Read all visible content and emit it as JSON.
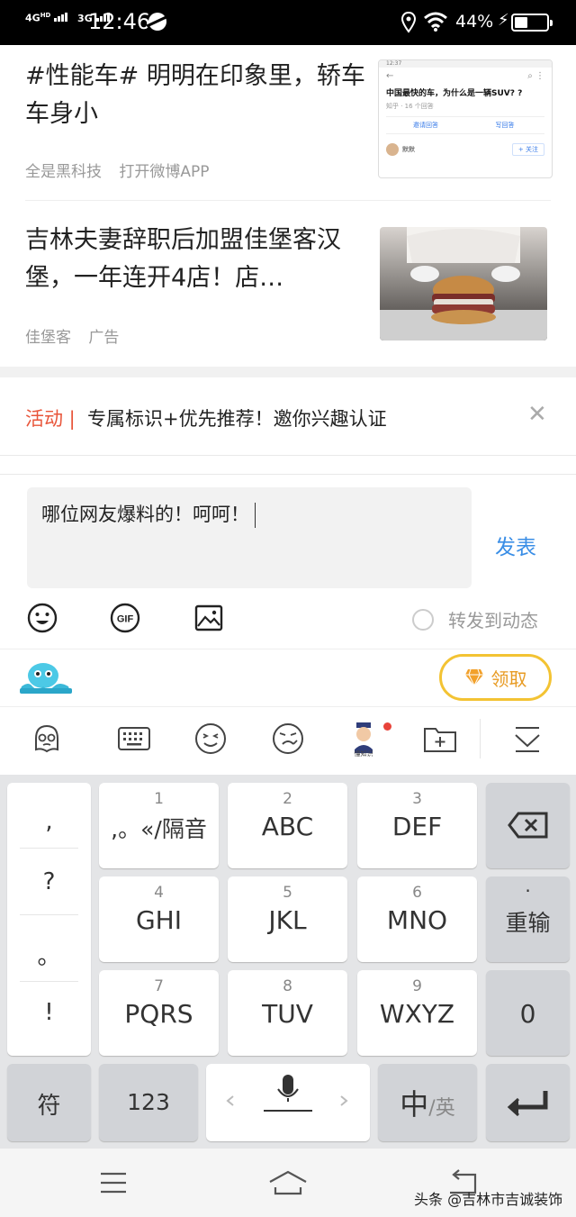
{
  "status_bar": {
    "network_1": "4G",
    "network_1_sup": "HD",
    "network_2": "3G",
    "time": "12:46",
    "battery_percent": "44%"
  },
  "feed": [
    {
      "title": "#性能车# 明明在印象里，轿车车身小",
      "meta": [
        "全是黑科技",
        "打开微博APP"
      ],
      "thumb": {
        "status_time": "12:37",
        "question": "中国最快的车，为什么是一辆SUV? ?",
        "sub": "知乎 · 16 个回答",
        "btn_invite": "邀请回答",
        "btn_write": "写回答",
        "user_name": "默默",
        "follow": "+ 关注"
      }
    },
    {
      "title": "吉林夫妻辞职后加盟佳堡客汉堡，一年连开4店！店…",
      "meta": [
        "佳堡客",
        "广告"
      ]
    }
  ],
  "activity": {
    "tag": "活动 |",
    "text": "专属标识+优先推荐！邀你兴趣认证"
  },
  "comment": {
    "input_value": "哪位网友爆料的！呵呵！",
    "publish_label": "发表",
    "forward_label": "转发到动态"
  },
  "keyboard": {
    "claim_label": "领取",
    "tool_badge_text": "懂知识",
    "punctuation": [
      ",",
      "?",
      "。",
      "!"
    ],
    "keys": [
      {
        "num": "1",
        "label": ",。«/隔音"
      },
      {
        "num": "2",
        "label": "ABC"
      },
      {
        "num": "3",
        "label": "DEF"
      },
      {
        "num": "4",
        "label": "GHI"
      },
      {
        "num": "5",
        "label": "JKL"
      },
      {
        "num": "6",
        "label": "MNO"
      },
      {
        "num": "7",
        "label": "PQRS"
      },
      {
        "num": "8",
        "label": "TUV"
      },
      {
        "num": "9",
        "label": "WXYZ"
      }
    ],
    "reinput_dot": "·",
    "reinput_label": "重输",
    "zero_label": "0",
    "symbol_label": "符",
    "num_label": "123",
    "lang_main": "中",
    "lang_alt": "/英"
  },
  "watermark": "头条 @吉林市吉诚装饰",
  "colors": {
    "accent_blue": "#3a8ee6",
    "activity_red": "#e8553a",
    "claim_gold": "#f3c333"
  }
}
